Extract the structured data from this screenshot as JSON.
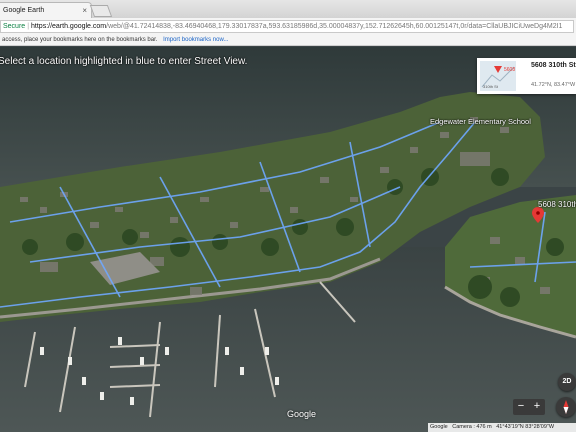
{
  "browser": {
    "tab_title": "Google Earth",
    "tab_close": "×",
    "security_label": "Secure",
    "url_host": "https://earth.google.com",
    "url_path": "/web/@41.72414838,-83.46940468,179.33017837a,593.63185986d,35.00004837y,152.71262645h,60.00125147t,0r/data=CllaUBJICiUweDg4M2I1",
    "bookmarks_text": "access, place your bookmarks here on the bookmarks bar.",
    "bookmarks_link": "Import bookmarks now..."
  },
  "map": {
    "hint": "Select a location highlighted in blue to enter Street View.",
    "place_label": "Edgewater Elementary School",
    "street_label": "5608 310th",
    "streetview_card": {
      "title": "5608 310th St",
      "coords": "41.72°N, 83.47°W",
      "thumb_label": "5608",
      "thumb_sublabel": "310th St"
    },
    "controls": {
      "mode_2d": "2D",
      "zoom_out": "−",
      "zoom_in": "+"
    },
    "logo": "Google",
    "status": {
      "attribution": "Google",
      "camera": "Camera : 476 m",
      "coords": "41°43'19\"N 83°28'09\"W"
    },
    "colors": {
      "water": "#3f4849",
      "land_green": "#4b6a36",
      "road_highlight": "#6fa8ff",
      "pin": "#e53935"
    }
  }
}
